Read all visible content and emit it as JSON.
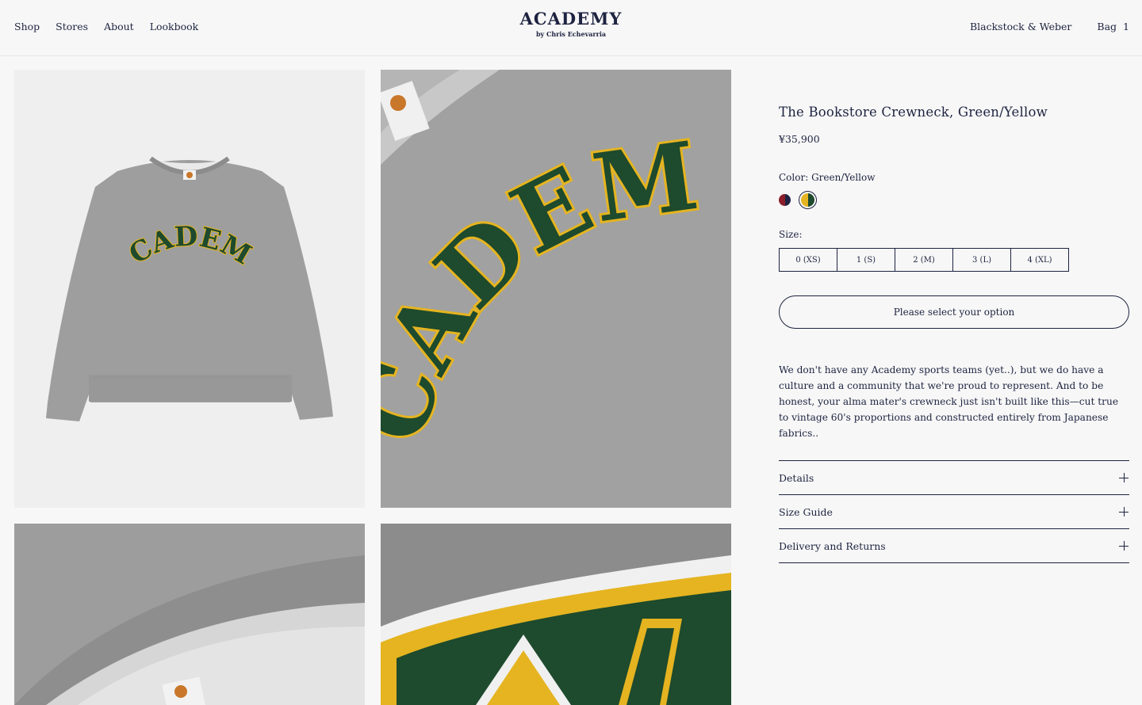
{
  "nav": {
    "left": [
      "Shop",
      "Stores",
      "About",
      "Lookbook"
    ],
    "right": {
      "store": "Blackstock & Weber",
      "bag_label": "Bag",
      "bag_count": "1"
    }
  },
  "brand": {
    "name": "ACADEMY",
    "byline": "by Chris Echevarria"
  },
  "gallery": {
    "images": [
      {
        "alt": "grey crewneck front view",
        "wordmark": "ACADEMY"
      },
      {
        "alt": "chest graphic close-up",
        "wordmark": "ACADEMY"
      },
      {
        "alt": "collar detail"
      },
      {
        "alt": "letter stitching detail"
      }
    ]
  },
  "product": {
    "title": "The Bookstore Crewneck, Green/Yellow",
    "price": "¥35,900",
    "color_label": "Color: Green/Yellow",
    "swatches": [
      {
        "name": "navy-red",
        "colors": [
          "#8b1e2b",
          "#1d2340"
        ],
        "selected": false
      },
      {
        "name": "green-yellow",
        "colors": [
          "#e5b420",
          "#1e4a2d"
        ],
        "selected": true
      }
    ],
    "size_label": "Size:",
    "sizes": [
      "0 (XS)",
      "1 (S)",
      "2 (M)",
      "3 (L)",
      "4 (XL)"
    ],
    "cta": "Please select your option",
    "description": "We don't have any Academy sports teams (yet..), but we do have a culture and a community that we're proud to represent. And to be honest, your alma mater's crewneck just isn't built like this—cut true to vintage 60's proportions and constructed entirely from Japanese fabrics..",
    "accordion": [
      "Details",
      "Size Guide",
      "Delivery and Returns"
    ]
  },
  "colors": {
    "ink": "#1d2340",
    "background": "#f7f7f7",
    "heather": "#9c9c9c",
    "green": "#1e4a2d",
    "yellow": "#e5b420"
  }
}
